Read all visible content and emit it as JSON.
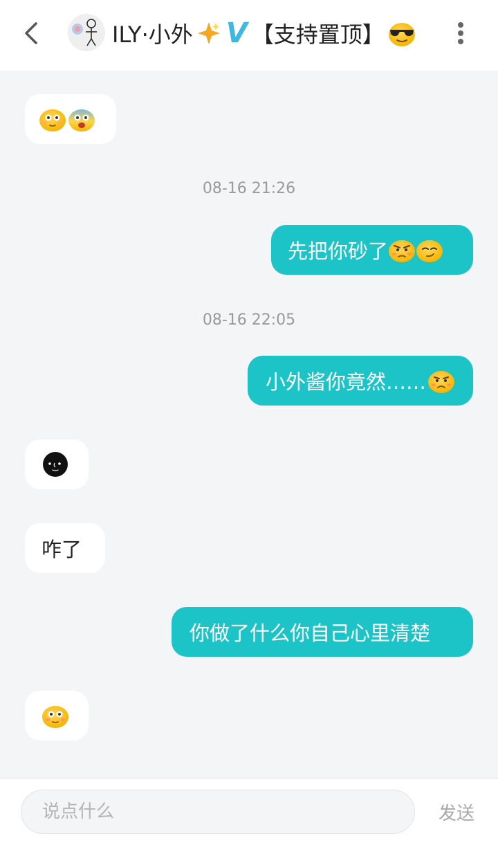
{
  "header": {
    "title_name": "ILY·小外",
    "title_badge": "V",
    "title_suffix": "【支持置顶】"
  },
  "messages": [
    {
      "side": "in",
      "kind": "emoji",
      "icons": [
        "blush-face-emoji",
        "fearful-face-emoji"
      ]
    },
    {
      "kind": "timestamp",
      "text": "08-16 21:26"
    },
    {
      "side": "out",
      "text": "先把你砂了",
      "icons": [
        "angry-face-emoji",
        "smirk-face-emoji"
      ]
    },
    {
      "kind": "timestamp",
      "text": "08-16 22:05"
    },
    {
      "side": "out",
      "text": "小外酱你竟然……",
      "icons": [
        "worried-face-emoji"
      ]
    },
    {
      "side": "in",
      "kind": "emoji",
      "icons": [
        "black-moon-face-emoji"
      ]
    },
    {
      "side": "in",
      "text": "咋了"
    },
    {
      "side": "out",
      "text": "你做了什么你自己心里清楚"
    },
    {
      "side": "in",
      "kind": "emoji",
      "icons": [
        "blush-face-emoji"
      ]
    }
  ],
  "footer": {
    "input_placeholder": "说点什么",
    "input_value": "",
    "send_label": "发送"
  },
  "colors": {
    "accent": "#1cc4c8",
    "background": "#f4f5f7",
    "incoming_bubble": "#ffffff",
    "verified_badge": "#3fb7e3"
  }
}
